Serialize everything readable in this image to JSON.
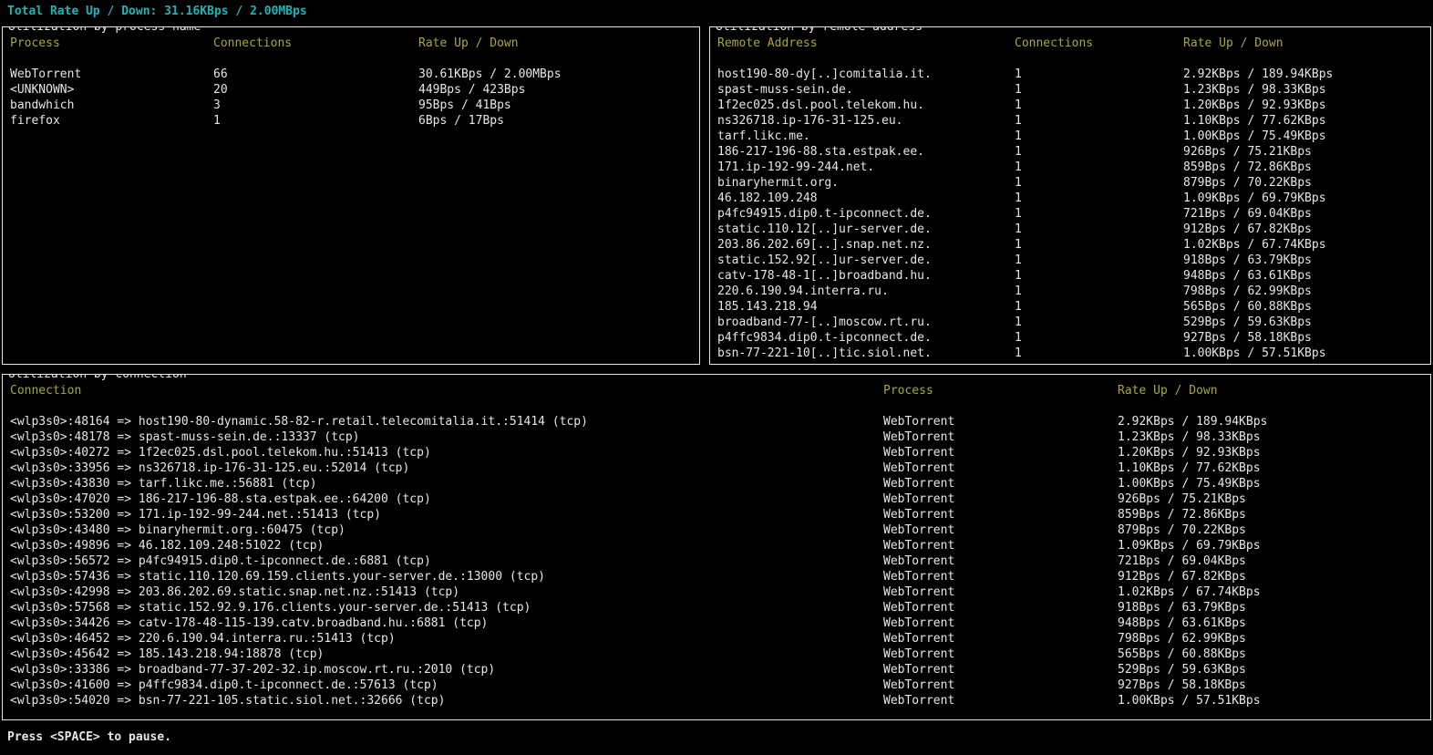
{
  "header": {
    "total_line": "Total Rate Up / Down: 31.16KBps / 2.00MBps"
  },
  "panels": {
    "process": {
      "title": "Utilization by process name",
      "columns": [
        "Process",
        "Connections",
        "Rate Up / Down"
      ],
      "rows": [
        [
          "WebTorrent",
          "66",
          "30.61KBps / 2.00MBps"
        ],
        [
          "<UNKNOWN>",
          "20",
          "449Bps / 423Bps"
        ],
        [
          "bandwhich",
          "3",
          "95Bps / 41Bps"
        ],
        [
          "firefox",
          "1",
          "6Bps / 17Bps"
        ]
      ]
    },
    "remote": {
      "title": "Utilization by remote address",
      "columns": [
        "Remote Address",
        "Connections",
        "Rate Up / Down"
      ],
      "rows": [
        [
          "host190-80-dy[..]comitalia.it.",
          "1",
          "2.92KBps / 189.94KBps"
        ],
        [
          "spast-muss-sein.de.",
          "1",
          "1.23KBps / 98.33KBps"
        ],
        [
          "1f2ec025.dsl.pool.telekom.hu.",
          "1",
          "1.20KBps / 92.93KBps"
        ],
        [
          "ns326718.ip-176-31-125.eu.",
          "1",
          "1.10KBps / 77.62KBps"
        ],
        [
          "tarf.likc.me.",
          "1",
          "1.00KBps / 75.49KBps"
        ],
        [
          "186-217-196-88.sta.estpak.ee.",
          "1",
          "926Bps / 75.21KBps"
        ],
        [
          "171.ip-192-99-244.net.",
          "1",
          "859Bps / 72.86KBps"
        ],
        [
          "binaryhermit.org.",
          "1",
          "879Bps / 70.22KBps"
        ],
        [
          "46.182.109.248",
          "1",
          "1.09KBps / 69.79KBps"
        ],
        [
          "p4fc94915.dip0.t-ipconnect.de.",
          "1",
          "721Bps / 69.04KBps"
        ],
        [
          "static.110.12[..]ur-server.de.",
          "1",
          "912Bps / 67.82KBps"
        ],
        [
          "203.86.202.69[..].snap.net.nz.",
          "1",
          "1.02KBps / 67.74KBps"
        ],
        [
          "static.152.92[..]ur-server.de.",
          "1",
          "918Bps / 63.79KBps"
        ],
        [
          "catv-178-48-1[..]broadband.hu.",
          "1",
          "948Bps / 63.61KBps"
        ],
        [
          "220.6.190.94.interra.ru.",
          "1",
          "798Bps / 62.99KBps"
        ],
        [
          "185.143.218.94",
          "1",
          "565Bps / 60.88KBps"
        ],
        [
          "broadband-77-[..]moscow.rt.ru.",
          "1",
          "529Bps / 59.63KBps"
        ],
        [
          "p4ffc9834.dip0.t-ipconnect.de.",
          "1",
          "927Bps / 58.18KBps"
        ],
        [
          "bsn-77-221-10[..]tic.siol.net.",
          "1",
          "1.00KBps / 57.51KBps"
        ]
      ]
    },
    "connection": {
      "title": "Utilization by connection",
      "columns": [
        "Connection",
        "Process",
        "Rate Up / Down"
      ],
      "rows": [
        [
          "<wlp3s0>:48164 => host190-80-dynamic.58-82-r.retail.telecomitalia.it.:51414 (tcp)",
          "WebTorrent",
          "2.92KBps / 189.94KBps"
        ],
        [
          "<wlp3s0>:48178 => spast-muss-sein.de.:13337 (tcp)",
          "WebTorrent",
          "1.23KBps / 98.33KBps"
        ],
        [
          "<wlp3s0>:40272 => 1f2ec025.dsl.pool.telekom.hu.:51413 (tcp)",
          "WebTorrent",
          "1.20KBps / 92.93KBps"
        ],
        [
          "<wlp3s0>:33956 => ns326718.ip-176-31-125.eu.:52014 (tcp)",
          "WebTorrent",
          "1.10KBps / 77.62KBps"
        ],
        [
          "<wlp3s0>:43830 => tarf.likc.me.:56881 (tcp)",
          "WebTorrent",
          "1.00KBps / 75.49KBps"
        ],
        [
          "<wlp3s0>:47020 => 186-217-196-88.sta.estpak.ee.:64200 (tcp)",
          "WebTorrent",
          "926Bps / 75.21KBps"
        ],
        [
          "<wlp3s0>:53200 => 171.ip-192-99-244.net.:51413 (tcp)",
          "WebTorrent",
          "859Bps / 72.86KBps"
        ],
        [
          "<wlp3s0>:43480 => binaryhermit.org.:60475 (tcp)",
          "WebTorrent",
          "879Bps / 70.22KBps"
        ],
        [
          "<wlp3s0>:49896 => 46.182.109.248:51022 (tcp)",
          "WebTorrent",
          "1.09KBps / 69.79KBps"
        ],
        [
          "<wlp3s0>:56572 => p4fc94915.dip0.t-ipconnect.de.:6881 (tcp)",
          "WebTorrent",
          "721Bps / 69.04KBps"
        ],
        [
          "<wlp3s0>:57436 => static.110.120.69.159.clients.your-server.de.:13000 (tcp)",
          "WebTorrent",
          "912Bps / 67.82KBps"
        ],
        [
          "<wlp3s0>:42998 => 203.86.202.69.static.snap.net.nz.:51413 (tcp)",
          "WebTorrent",
          "1.02KBps / 67.74KBps"
        ],
        [
          "<wlp3s0>:57568 => static.152.92.9.176.clients.your-server.de.:51413 (tcp)",
          "WebTorrent",
          "918Bps / 63.79KBps"
        ],
        [
          "<wlp3s0>:34426 => catv-178-48-115-139.catv.broadband.hu.:6881 (tcp)",
          "WebTorrent",
          "948Bps / 63.61KBps"
        ],
        [
          "<wlp3s0>:46452 => 220.6.190.94.interra.ru.:51413 (tcp)",
          "WebTorrent",
          "798Bps / 62.99KBps"
        ],
        [
          "<wlp3s0>:45642 => 185.143.218.94:18878 (tcp)",
          "WebTorrent",
          "565Bps / 60.88KBps"
        ],
        [
          "<wlp3s0>:33386 => broadband-77-37-202-32.ip.moscow.rt.ru.:2010 (tcp)",
          "WebTorrent",
          "529Bps / 59.63KBps"
        ],
        [
          "<wlp3s0>:41600 => p4ffc9834.dip0.t-ipconnect.de.:57613 (tcp)",
          "WebTorrent",
          "927Bps / 58.18KBps"
        ],
        [
          "<wlp3s0>:54020 => bsn-77-221-105.static.siol.net.:32666 (tcp)",
          "WebTorrent",
          "1.00KBps / 57.51KBps"
        ]
      ]
    }
  },
  "footer": {
    "text": "Press <SPACE> to pause."
  },
  "colors": {
    "background": "#000000",
    "body_text": "#e6e6e6",
    "total_rate": "#1ab5b5",
    "column_header": "#a6a642",
    "border": "#e6e6e6"
  }
}
